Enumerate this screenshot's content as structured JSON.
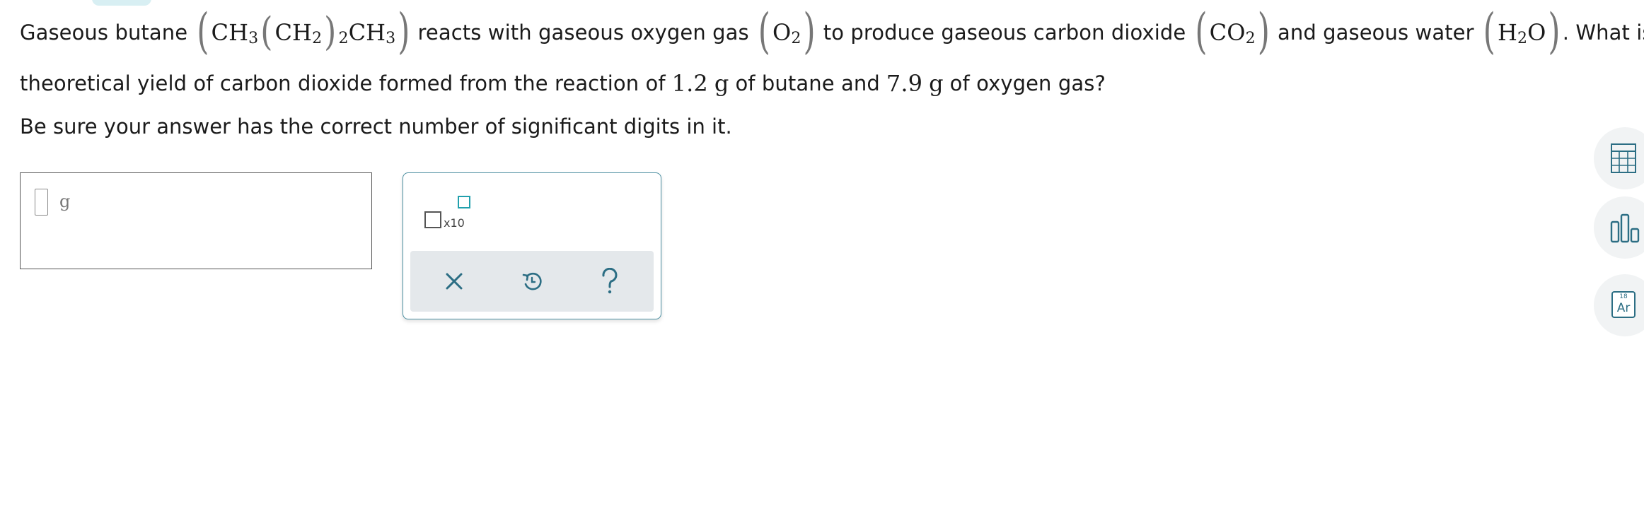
{
  "question": {
    "intro": "Gaseous butane",
    "butane": {
      "ch": "CH",
      "s3": "3",
      "ch2": "CH",
      "s2": "2",
      "outer": "2",
      "ch3b": "CH",
      "s3b": "3"
    },
    "mid1": "reacts with gaseous oxygen gas",
    "oxygen": {
      "o": "O",
      "s": "2"
    },
    "mid2": "to produce gaseous carbon dioxide",
    "co2": {
      "c": "CO",
      "s": "2"
    },
    "mid3": "and gaseous water",
    "water": {
      "h": "H",
      "s": "2",
      "o": "O"
    },
    "tail1": ". What is the",
    "line2_a": "theoretical yield of carbon dioxide formed from the reaction of",
    "mass1": "1.2",
    "unit_g": "g",
    "line2_b": "of butane and",
    "mass2": "7.9",
    "line2_c": "of oxygen gas?"
  },
  "note": "Be sure your answer has the correct number of significant digits in it.",
  "answer": {
    "unit": "g"
  },
  "keypad": {
    "x10_label": "x10"
  },
  "tools": {
    "periodic_number": "18",
    "periodic_symbol": "Ar"
  },
  "colors": {
    "accent": "#21a0ad",
    "icon": "#2c6e84",
    "keypad_border": "#4a8ea0"
  }
}
